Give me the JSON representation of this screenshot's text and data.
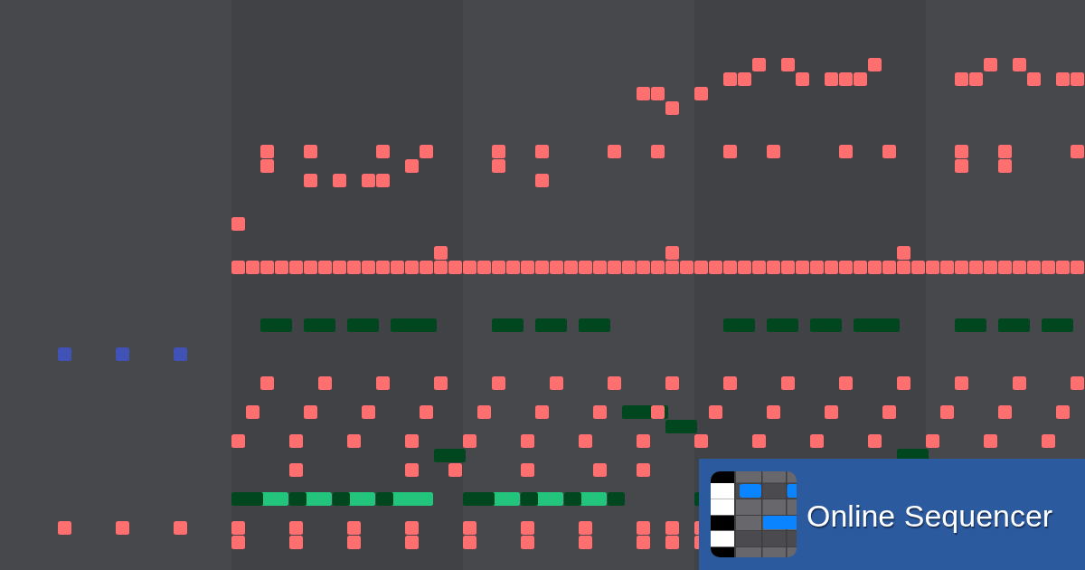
{
  "banner": {
    "title": "Online Sequencer"
  }
}
